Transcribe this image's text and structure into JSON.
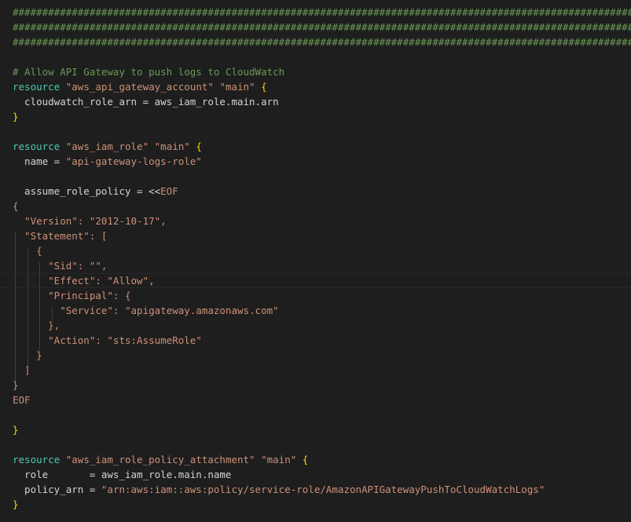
{
  "editor": {
    "language": "terraform",
    "theme_colors": {
      "background": "#1e1e1e",
      "comment": "#6a9955",
      "keyword": "#4ec9b0",
      "string": "#ce9178",
      "text": "#d4d4d4",
      "bracket": "#ffd700"
    },
    "current_line": 18,
    "lines": [
      [
        [
          "c",
          "##############################################################################################################"
        ]
      ],
      [
        [
          "c",
          "##############################################################################################################"
        ]
      ],
      [
        [
          "c",
          "##############################################################################################################"
        ]
      ],
      [],
      [
        [
          "c",
          "# Allow API Gateway to push logs to CloudWatch"
        ]
      ],
      [
        [
          "k",
          "resource"
        ],
        [
          "t",
          " "
        ],
        [
          "s",
          "\"aws_api_gateway_account\""
        ],
        [
          "t",
          " "
        ],
        [
          "s",
          "\"main\""
        ],
        [
          "t",
          " "
        ],
        [
          "b",
          "{"
        ]
      ],
      [
        [
          "t",
          "  cloudwatch_role_arn = aws_iam_role.main.arn"
        ]
      ],
      [
        [
          "b",
          "}"
        ]
      ],
      [],
      [
        [
          "k",
          "resource"
        ],
        [
          "t",
          " "
        ],
        [
          "s",
          "\"aws_iam_role\""
        ],
        [
          "t",
          " "
        ],
        [
          "s",
          "\"main\""
        ],
        [
          "t",
          " "
        ],
        [
          "b",
          "{"
        ]
      ],
      [
        [
          "t",
          "  name = "
        ],
        [
          "s",
          "\"api-gateway-logs-role\""
        ]
      ],
      [],
      [
        [
          "t",
          "  assume_role_policy = <<"
        ],
        [
          "h",
          "EOF"
        ]
      ],
      [
        [
          "s",
          "{"
        ]
      ],
      [
        [
          "s",
          "  \"Version\": \"2012-10-17\","
        ]
      ],
      [
        [
          "s",
          "  \"Statement\": ["
        ]
      ],
      [
        [
          "s",
          "    {"
        ]
      ],
      [
        [
          "s",
          "      \"Sid\": \"\","
        ]
      ],
      [
        [
          "s",
          "      \"Effect\": \"Allow\","
        ]
      ],
      [
        [
          "s",
          "      \"Principal\": {"
        ]
      ],
      [
        [
          "s",
          "        \"Service\": \"apigateway.amazonaws.com\""
        ]
      ],
      [
        [
          "s",
          "      },"
        ]
      ],
      [
        [
          "s",
          "      \"Action\": \"sts:AssumeRole\""
        ]
      ],
      [
        [
          "s",
          "    }"
        ]
      ],
      [
        [
          "s",
          "  ]"
        ]
      ],
      [
        [
          "s",
          "}"
        ]
      ],
      [
        [
          "s",
          "EOF"
        ]
      ],
      [],
      [
        [
          "b",
          "}"
        ]
      ],
      [],
      [
        [
          "k",
          "resource"
        ],
        [
          "t",
          " "
        ],
        [
          "s",
          "\"aws_iam_role_policy_attachment\""
        ],
        [
          "t",
          " "
        ],
        [
          "s",
          "\"main\""
        ],
        [
          "t",
          " "
        ],
        [
          "b",
          "{"
        ]
      ],
      [
        [
          "t",
          "  role       = aws_iam_role.main.name"
        ]
      ],
      [
        [
          "t",
          "  policy_arn = "
        ],
        [
          "s",
          "\"arn:aws:iam::aws:policy/service-role/AmazonAPIGatewayPushToCloudWatchLogs\""
        ]
      ],
      [
        [
          "b",
          "}"
        ]
      ]
    ]
  }
}
